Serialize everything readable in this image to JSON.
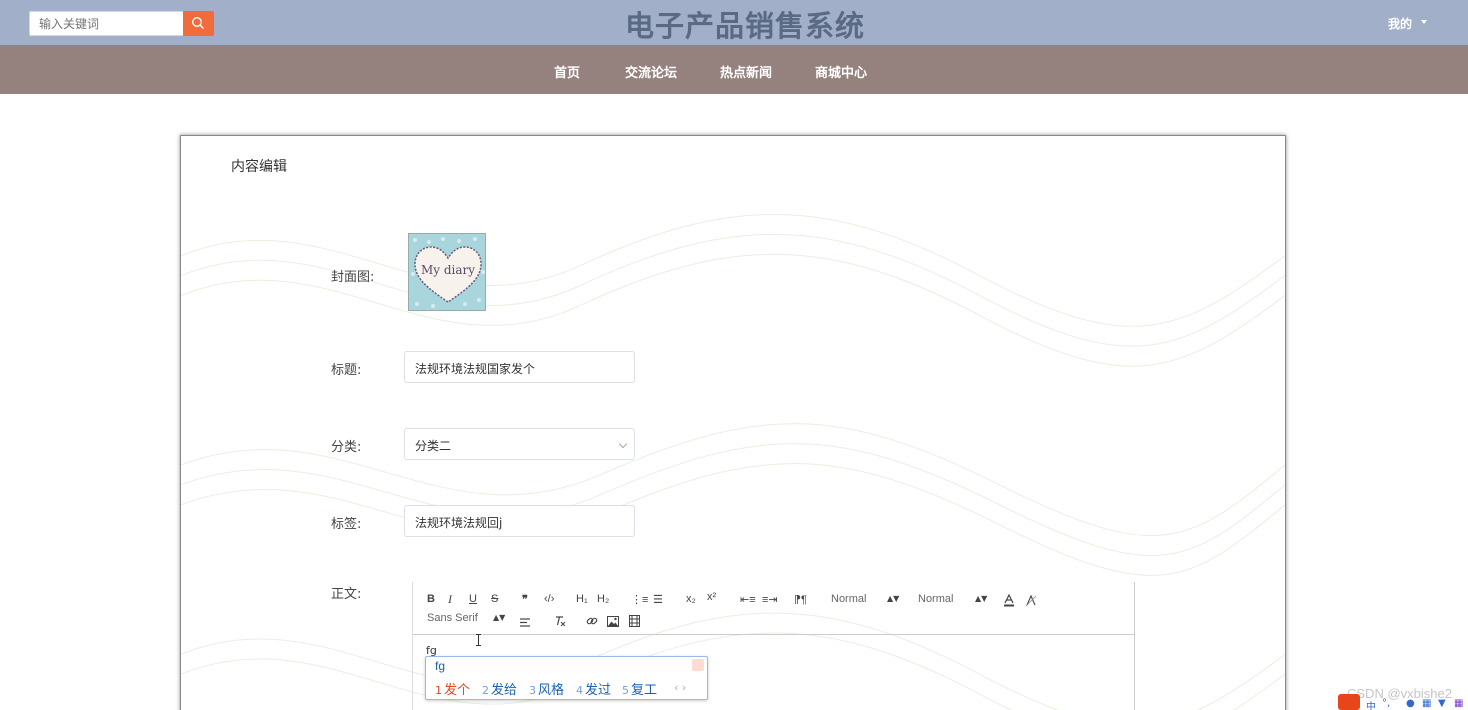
{
  "header": {
    "search_placeholder": "输入关键词",
    "site_title": "电子产品销售系统",
    "user_menu": "我的"
  },
  "nav": {
    "items": [
      {
        "label": "首页"
      },
      {
        "label": "交流论坛"
      },
      {
        "label": "热点新闻"
      },
      {
        "label": "商城中心"
      }
    ]
  },
  "form": {
    "section_title": "内容编辑",
    "cover_label": "封面图:",
    "cover_image_text": "My diary",
    "title_label": "标题:",
    "title_value": "法规环境法规国家发个",
    "category_label": "分类:",
    "category_value": "分类二",
    "tags_label": "标签:",
    "tags_value": "法规环境法规回j",
    "body_label": "正文:"
  },
  "editor": {
    "toolbar_row1": [
      "B",
      "I",
      "U",
      "S",
      "❞",
      "‹/›",
      "H₁",
      "H₂",
      "⋮≡",
      "☰",
      "x₂",
      "x²",
      "⇤≡",
      "≡⇥",
      "⁋¶"
    ],
    "size_picker": "Normal",
    "header_picker": "Normal",
    "font_picker": "Sans Serif",
    "content": "fg"
  },
  "ime": {
    "input": "fg",
    "candidates": [
      {
        "num": "1",
        "text": "发个"
      },
      {
        "num": "2",
        "text": "发给"
      },
      {
        "num": "3",
        "text": "风格"
      },
      {
        "num": "4",
        "text": "发过"
      },
      {
        "num": "5",
        "text": "复工"
      }
    ],
    "pager": "‹ ›"
  },
  "watermark": "CSDN @vxbishe2",
  "colors": {
    "topbar": "#a2afc8",
    "navbar": "#95827e",
    "search_button": "#f26b3a",
    "title": "#5a6a84"
  }
}
